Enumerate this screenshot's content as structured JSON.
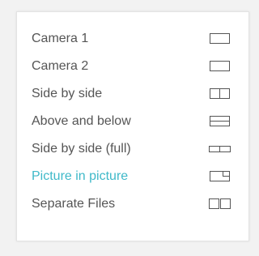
{
  "menu": {
    "items": [
      {
        "label": "Camera 1",
        "icon": "single-frame-icon",
        "selected": false
      },
      {
        "label": "Camera 2",
        "icon": "single-frame-icon",
        "selected": false
      },
      {
        "label": "Side by side",
        "icon": "split-vertical-icon",
        "selected": false
      },
      {
        "label": "Above and below",
        "icon": "split-horizontal-icon",
        "selected": false
      },
      {
        "label": "Side by side (full)",
        "icon": "split-vertical-wide-icon",
        "selected": false
      },
      {
        "label": "Picture in picture",
        "icon": "picture-in-picture-icon",
        "selected": true
      },
      {
        "label": "Separate Files",
        "icon": "separate-files-icon",
        "selected": false
      }
    ]
  },
  "colors": {
    "text": "#555555",
    "accent": "#3fb9c9",
    "icon_stroke": "#555555"
  }
}
